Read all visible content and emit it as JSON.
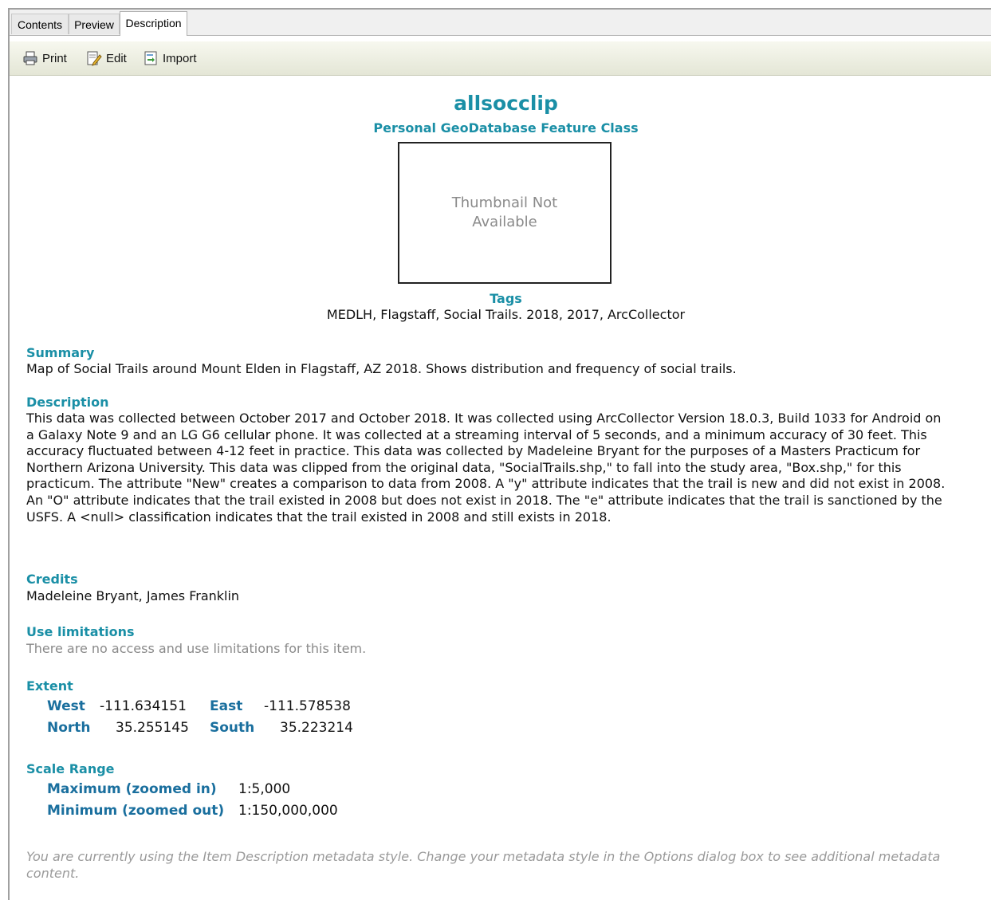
{
  "tabs": [
    {
      "label": "Contents"
    },
    {
      "label": "Preview"
    },
    {
      "label": "Description"
    }
  ],
  "toolbar": {
    "print_label": "Print",
    "edit_label": "Edit",
    "import_label": "Import"
  },
  "item": {
    "title": "allsocclip",
    "subtitle": "Personal GeoDatabase Feature Class",
    "thumbnail_text": "Thumbnail Not Available"
  },
  "tags": {
    "heading": "Tags",
    "value": "MEDLH, Flagstaff, Social Trails. 2018, 2017, ArcCollector"
  },
  "summary": {
    "heading": "Summary",
    "text": "Map of Social Trails around Mount Elden in Flagstaff, AZ 2018. Shows distribution and frequency of social trails."
  },
  "description": {
    "heading": "Description",
    "text": "This data was collected between October 2017 and October 2018. It was collected using ArcCollector Version 18.0.3, Build 1033 for Android on a Galaxy Note 9 and an LG G6 cellular phone. It was collected at a streaming interval of 5 seconds, and a minimum accuracy of 30 feet. This accuracy fluctuated between 4-12 feet in practice. This data was collected by Madeleine Bryant for the purposes of a Masters Practicum for Northern Arizona University. This data was clipped from the original data, \"SocialTrails.shp,\" to fall into the study area, \"Box.shp,\" for this practicum. The attribute \"New\" creates a comparison to data from 2008. A \"y\" attribute indicates that the trail is new and did not exist in 2008. An \"O\" attribute indicates that the trail existed in 2008 but does not exist in 2018. The \"e\" attribute indicates that the trail is sanctioned by the USFS. A <null> classification indicates that the trail existed in 2008 and still exists in 2018."
  },
  "credits": {
    "heading": "Credits",
    "text": "Madeleine Bryant, James Franklin"
  },
  "use_limitations": {
    "heading": "Use limitations",
    "text": "There are no access and use limitations for this item."
  },
  "extent": {
    "heading": "Extent",
    "west_label": "West",
    "west_value": "-111.634151",
    "east_label": "East",
    "east_value": "-111.578538",
    "north_label": "North",
    "north_value": "35.255145",
    "south_label": "South",
    "south_value": "35.223214"
  },
  "scale_range": {
    "heading": "Scale Range",
    "max_label": "Maximum (zoomed in)",
    "max_value": "1:5,000",
    "min_label": "Minimum (zoomed out)",
    "min_value": "1:150,000,000"
  },
  "footer": {
    "text": "You are currently using the Item Description metadata style. Change your metadata style in the Options dialog box to see additional metadata content."
  },
  "colors": {
    "heading": "#1a8fa6",
    "label": "#1a6f9e",
    "muted": "#8a8a8a"
  }
}
